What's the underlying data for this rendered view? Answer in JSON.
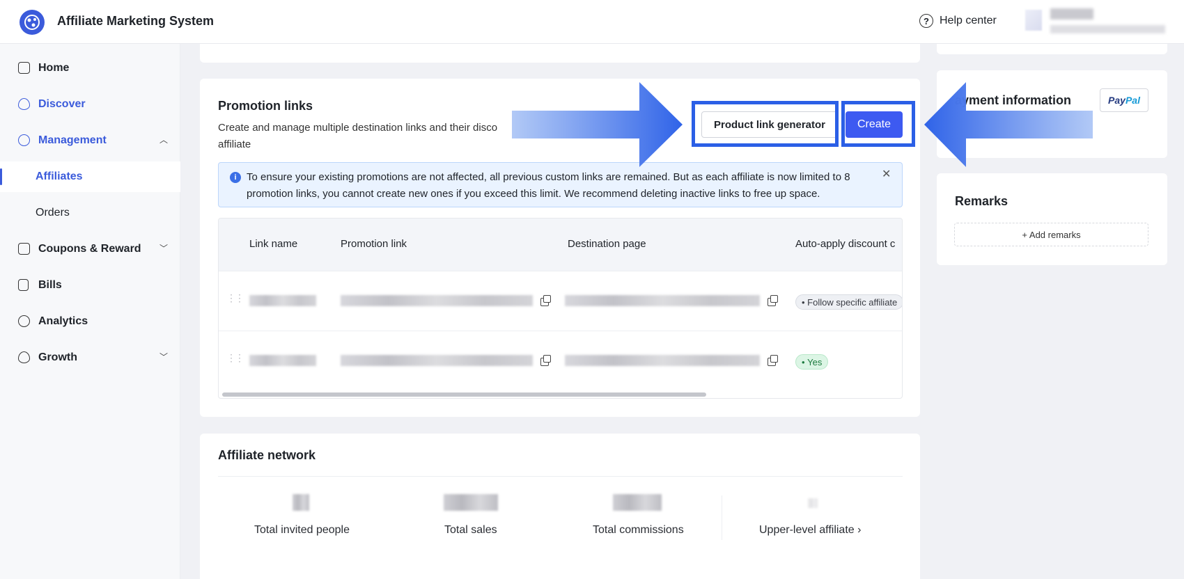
{
  "header": {
    "app_title": "Affiliate Marketing System",
    "help_label": "Help center"
  },
  "sidebar": {
    "items": [
      {
        "label": "Home"
      },
      {
        "label": "Discover"
      },
      {
        "label": "Management"
      },
      {
        "label": "Affiliates"
      },
      {
        "label": "Orders"
      },
      {
        "label": "Coupons & Reward"
      },
      {
        "label": "Bills"
      },
      {
        "label": "Analytics"
      },
      {
        "label": "Growth"
      }
    ]
  },
  "promotion": {
    "title": "Promotion links",
    "description": "Create and manage multiple destination links and their disco affiliate",
    "generator_label": "Product link generator",
    "create_label": "Create",
    "notice": "To ensure your existing promotions are not affected, all previous custom links are remained. But as each affiliate is now limited to 8 promotion links, you cannot create new ones if you exceed this limit. We recommend deleting inactive links to free up space.",
    "columns": [
      "Link name",
      "Promotion link",
      "Destination page",
      "Auto-apply discount c"
    ],
    "rows": [
      {
        "discount_tag": "Follow specific affiliate"
      },
      {
        "discount_tag": "Yes"
      }
    ]
  },
  "network": {
    "title": "Affiliate network",
    "stats": [
      {
        "label": "Total invited people"
      },
      {
        "label": "Total sales"
      },
      {
        "label": "Total commissions"
      },
      {
        "label": "Upper-level affiliate ›"
      }
    ]
  },
  "payment": {
    "title": "ayment information",
    "paypal_pay": "Pay",
    "paypal_pal": "Pal"
  },
  "remarks": {
    "title": "Remarks",
    "add_label": "+   Add remarks"
  },
  "colors": {
    "accent": "#3d5af1",
    "highlight": "#2b5fe6",
    "notice_bg": "#eaf3ff"
  }
}
